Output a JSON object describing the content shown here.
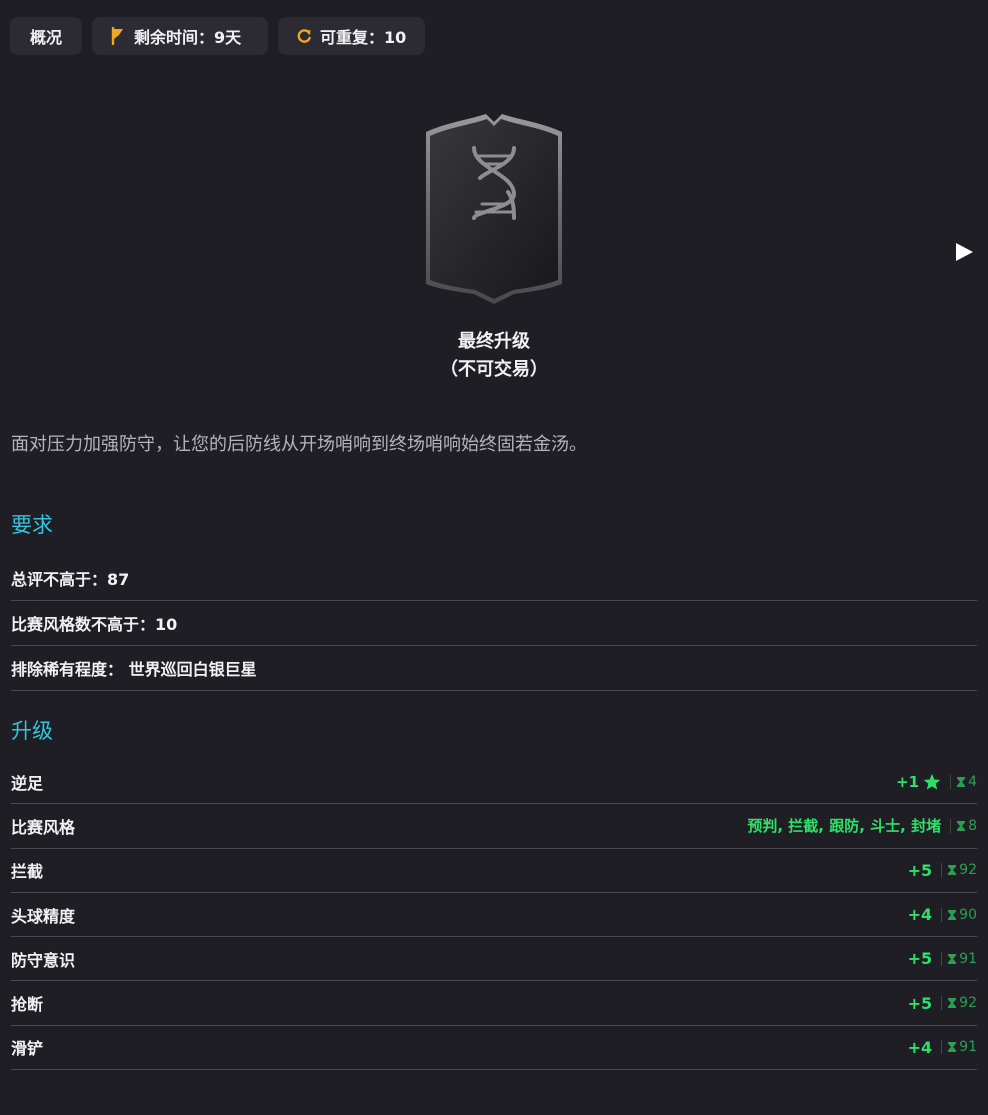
{
  "chips": {
    "overview": "概况",
    "time_left": "剩余时间：9天",
    "repeatable": "可重复：10"
  },
  "card": {
    "title": "最终升级",
    "subtitle": "（不可交易）"
  },
  "description": "面对压力加强防守，让您的后防线从开场哨响到终场哨响始终固若金汤。",
  "requirements": {
    "heading": "要求",
    "items": [
      "总评不高于：87",
      "比赛风格数不高于：10",
      "排除稀有程度： 世界巡回白银巨星"
    ]
  },
  "upgrades": {
    "heading": "升级",
    "items": [
      {
        "label": "逆足",
        "value": "+1",
        "cap": "4"
      },
      {
        "label": "比赛风格",
        "value": "预判, 拦截, 跟防, 斗士, 封堵",
        "cap": "8"
      },
      {
        "label": "拦截",
        "value": "+5",
        "cap": "92"
      },
      {
        "label": "头球精度",
        "value": "+4",
        "cap": "90"
      },
      {
        "label": "防守意识",
        "value": "+5",
        "cap": "91"
      },
      {
        "label": "抢断",
        "value": "+5",
        "cap": "92"
      },
      {
        "label": "滑铲",
        "value": "+4",
        "cap": "91"
      }
    ]
  },
  "colors": {
    "background": "#1f1e24",
    "accent": "#32c4dd",
    "positive": "#2ee06a",
    "chip": "#2c2b33",
    "timer_icon": "#f0a81e"
  },
  "icons": {
    "timer": "hourglass-flag-icon",
    "repeat": "refresh-icon",
    "card": "dna-icon",
    "next": "play-arrow-icon",
    "star": "star-icon",
    "cap": "hourglass-icon"
  }
}
